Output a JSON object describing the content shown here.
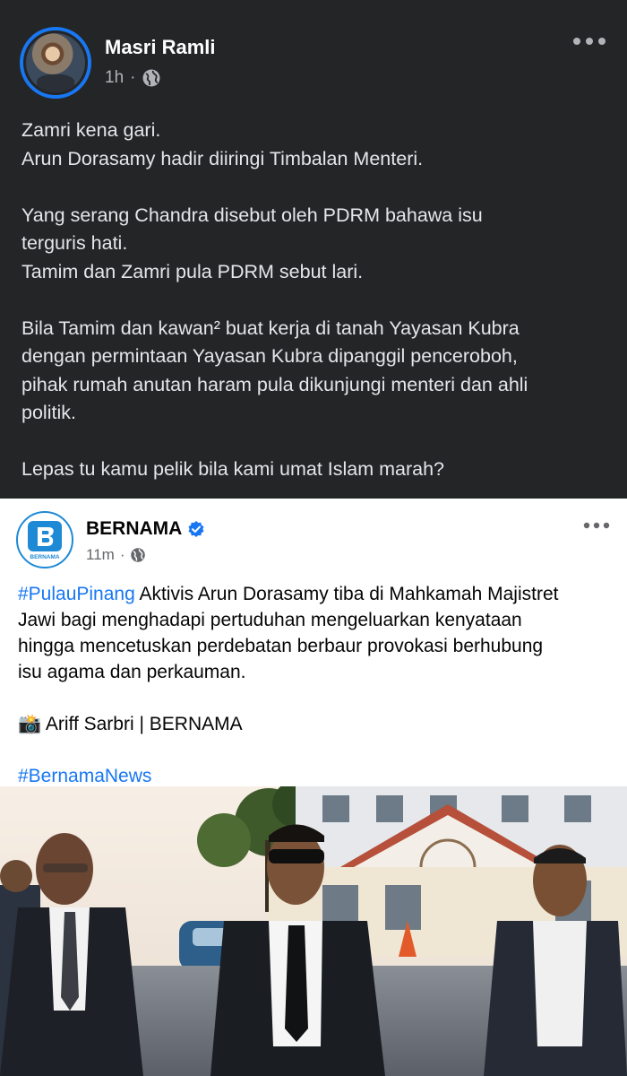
{
  "post_original": {
    "author_name": "Masri Ramli",
    "time": "1h",
    "time_separator": "·",
    "privacy_icon": "globe-icon",
    "more_icon": "more-options-icon",
    "paragraphs": [
      "Zamri kena gari.",
      "Arun Dorasamy hadir diiringi Timbalan Menteri.",
      "",
      "Yang serang Chandra disebut  oleh PDRM bahawa isu",
      "terguris hati.",
      "Tamim dan Zamri pula PDRM sebut lari.",
      "",
      "Bila Tamim dan kawan² buat kerja di tanah Yayasan Kubra",
      "dengan permintaan Yayasan Kubra dipanggil penceroboh,",
      "pihak rumah anutan haram pula dikunjungi menteri dan ahli",
      "politik.",
      "",
      "Lepas tu kamu pelik bila kami umat Islam marah?"
    ]
  },
  "post_shared": {
    "author_name": "BERNAMA",
    "verified_icon": "verified-badge-icon",
    "time": "11m",
    "time_separator": "·",
    "privacy_icon": "globe-icon",
    "more_icon": "more-options-icon",
    "logo_text": "BERNAMA",
    "hashtag_1": "#PulauPinang",
    "text_line_1": " Aktivis Arun Dorasamy tiba di Mahkamah Majistret",
    "text_line_2": "Jawi bagi menghadapi pertuduhan mengeluarkan kenyataan",
    "text_line_3": "hingga mencetuskan perdebatan berbaur provokasi berhubung",
    "text_line_4": "isu agama dan perkauman.",
    "credit_icon": "camera-emoji-icon",
    "credit_text": " Ariff Sarbri | BERNAMA",
    "hashtag_2": "#BernamaNews"
  },
  "colors": {
    "dark_bg": "#242526",
    "accent_blue": "#1877f2",
    "bernama_blue": "#1e8ad6"
  }
}
